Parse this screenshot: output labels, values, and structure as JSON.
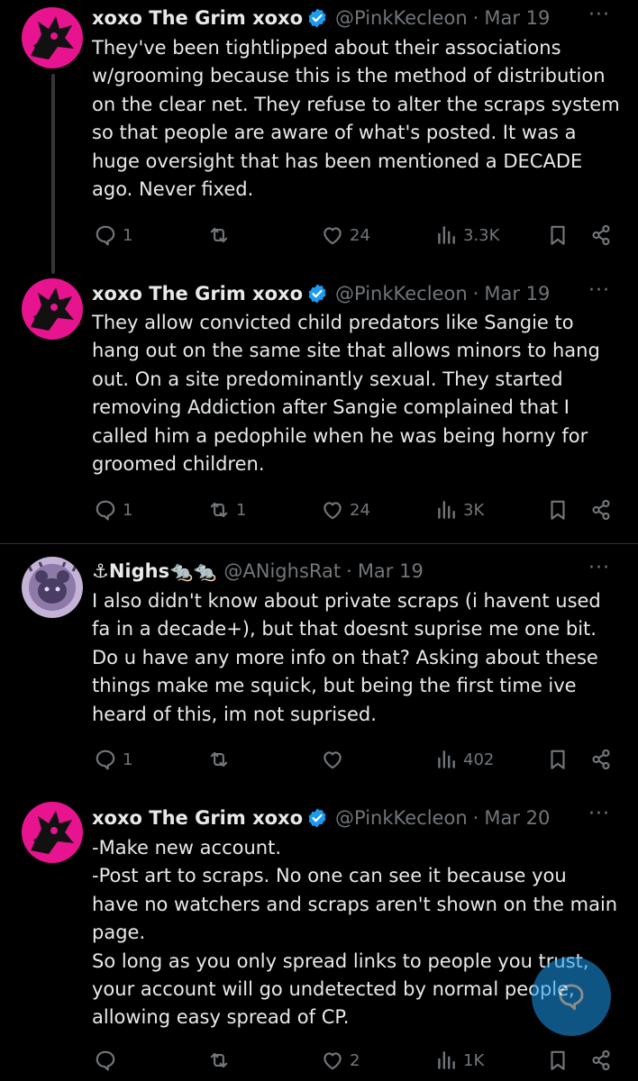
{
  "tweets": [
    {
      "name": "xoxo The Grim xoxo",
      "handle": "@PinkKecleon",
      "sep": "·",
      "date": "Mar 19",
      "more": "···",
      "text": "They've been tightlipped about their associations\nw/grooming because this is the method of distribution\non the clear net. They refuse to alter the scraps system\nso that people are aware of what's posted. It was a\nhuge oversight that has been mentioned a DECADE\nago. Never fixed.",
      "replies": "1",
      "reposts": "",
      "likes": "24",
      "views": "3.3K"
    },
    {
      "name": "xoxo The Grim xoxo",
      "handle": "@PinkKecleon",
      "sep": "·",
      "date": "Mar 19",
      "more": "···",
      "text": "They allow convicted child predators like Sangie to\nhang out on the same site that allows minors to hang\nout. On a site predominantly sexual. They started\nremoving Addiction after Sangie complained that I\ncalled him a pedophile when he was being horny for\ngroomed children.",
      "replies": "1",
      "reposts": "1",
      "likes": "24",
      "views": "3K"
    },
    {
      "name": "⚓Nighs🐀🐀",
      "handle": "@ANighsRat",
      "sep": "·",
      "date": "Mar 19",
      "more": "···",
      "text": "I also didn't know about private scraps (i havent used\nfa in a decade+), but that doesnt suprise me one bit.\nDo u have any more info on that? Asking about these\nthings make me squick, but being the first time ive\nheard of this, im not suprised.",
      "replies": "1",
      "reposts": "",
      "likes": "",
      "views": "402"
    },
    {
      "name": "xoxo The Grim xoxo",
      "handle": "@PinkKecleon",
      "sep": "·",
      "date": "Mar 20",
      "more": "···",
      "text": "-Make new account.\n-Post art to scraps. No one can see it because you\nhave no watchers and scraps aren't shown on the main\npage.\nSo long as you only spread links to people you trust,\nyour account will go undetected by normal people,\nallowing easy spread of CP.",
      "replies": "",
      "reposts": "",
      "likes": "2",
      "views": "1K"
    }
  ],
  "colors": {
    "background": "#000000",
    "text": "#e7e9ea",
    "muted": "#71767b",
    "accent": "#1d9bf0",
    "avatar_pink": "#e8138f"
  },
  "icons": [
    "reply-icon",
    "repost-icon",
    "like-icon",
    "views-icon",
    "bookmark-icon",
    "share-icon",
    "verified-icon",
    "more-icon",
    "compose-icon"
  ]
}
